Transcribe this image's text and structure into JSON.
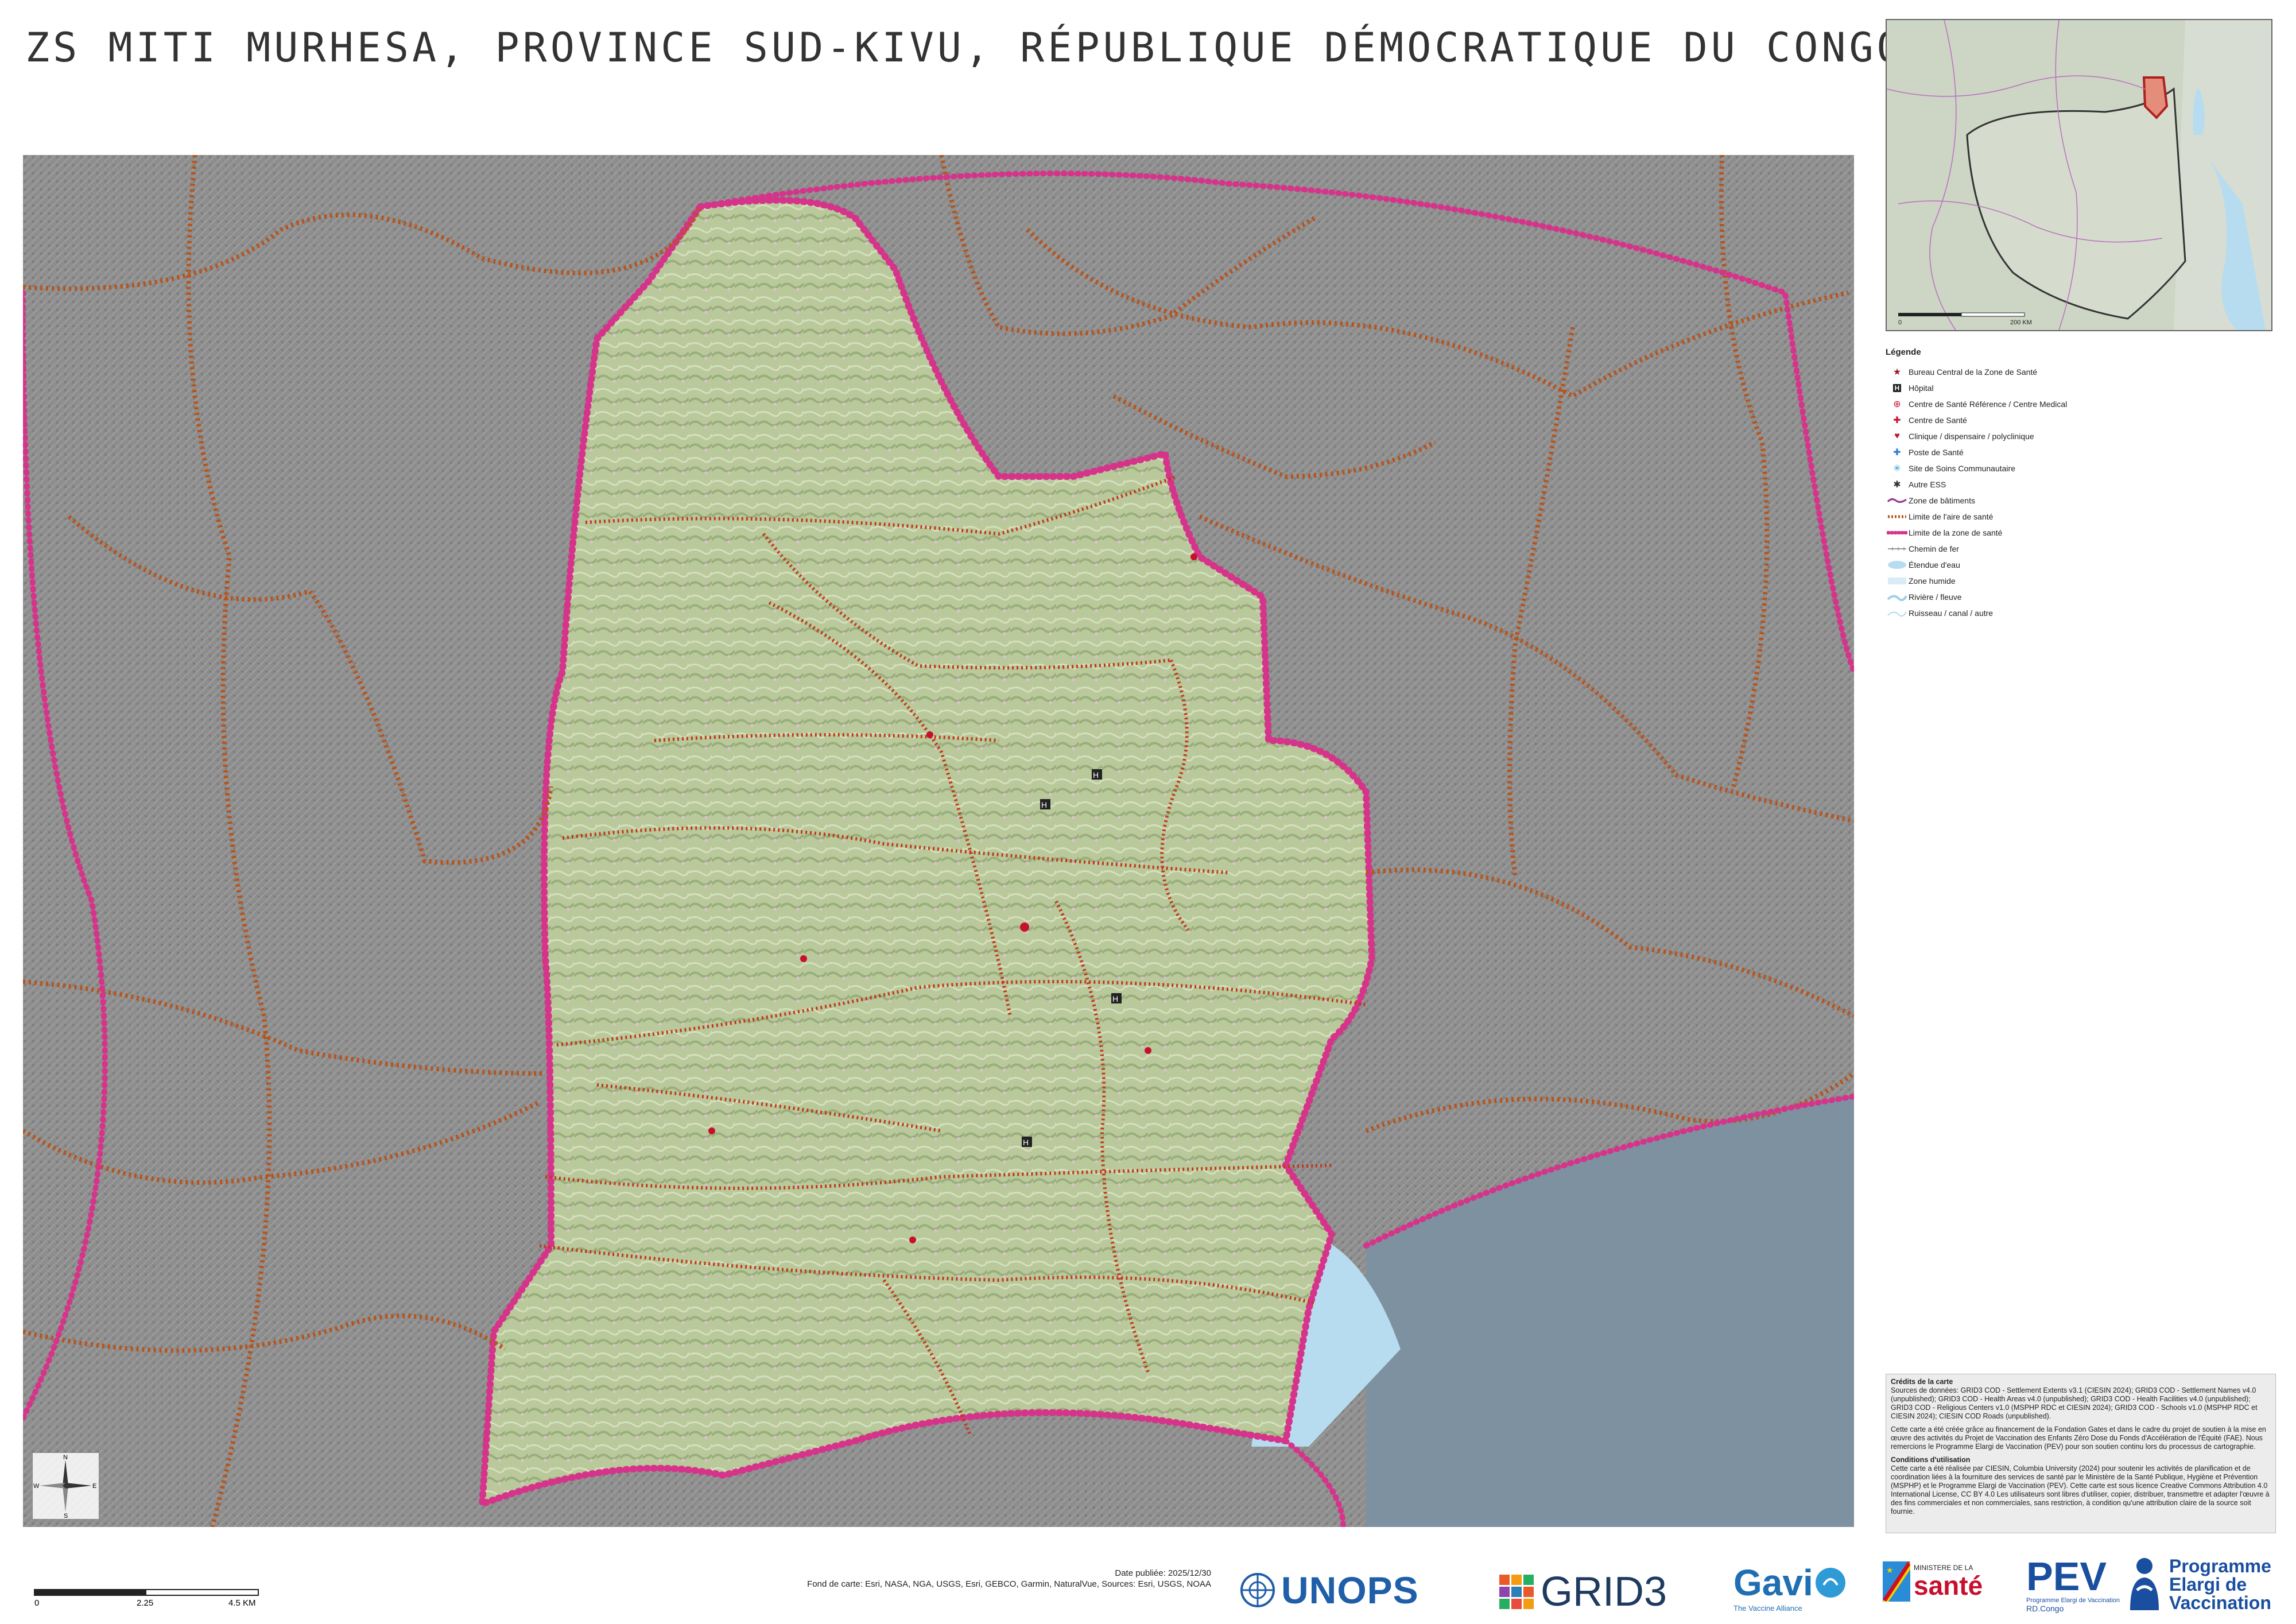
{
  "title": "ZS MITI MURHESA, PROVINCE SUD-KIVU, RÉPUBLIQUE DÉMOCRATIQUE DU CONGO",
  "colors": {
    "zone_boundary": "#d6338a",
    "area_boundary": "#b5541e",
    "outside_fill": "#8c8c8c",
    "inside_fill": "#b8c99a",
    "water": "#b7dcef",
    "lake_outside": "#7f93a3"
  },
  "inset": {
    "scale_start": "0",
    "scale_end": "200 KM"
  },
  "legend": {
    "title": "Légende",
    "items": [
      {
        "icon": "star-icon",
        "label": "Bureau Central de la Zone de Santé"
      },
      {
        "icon": "hospital-h-icon",
        "label": "Hôpital"
      },
      {
        "icon": "reference-health-center-icon",
        "label": "Centre de Santé Référence / Centre Medical"
      },
      {
        "icon": "health-center-icon",
        "label": "Centre de Santé"
      },
      {
        "icon": "clinic-icon",
        "label": "Clinique / dispensaire / polyclinique"
      },
      {
        "icon": "health-post-icon",
        "label": "Poste de Santé"
      },
      {
        "icon": "community-care-icon",
        "label": "Site de Soins Communautaire"
      },
      {
        "icon": "other-ess-icon",
        "label": "Autre ESS"
      },
      {
        "icon": "building-zone-icon",
        "label": "Zone de bâtiments"
      },
      {
        "icon": "health-area-line-icon",
        "label": "Limite de l'aire de santé"
      },
      {
        "icon": "health-zone-line-icon",
        "label": "Limite de la zone de santé"
      },
      {
        "icon": "railway-icon",
        "label": "Chemin de fer"
      },
      {
        "icon": "water-body-icon",
        "label": "Étendue d'eau"
      },
      {
        "icon": "wetland-icon",
        "label": "Zone humide"
      },
      {
        "icon": "river-icon",
        "label": "Rivière / fleuve"
      },
      {
        "icon": "stream-icon",
        "label": "Ruisseau / canal / autre"
      }
    ]
  },
  "credits": {
    "title": "Crédits de la carte",
    "sources": "Sources de données: GRID3 COD - Settlement Extents v3.1 (CIESIN 2024); GRID3 COD - Settlement Names v4.0 (unpublished); GRID3 COD - Health Areas v4.0 (unpublished); GRID3 COD - Health Facilities v4.0 (unpublished); GRID3 COD - Religious Centers v1.0 (MSPHP RDC et CIESIN 2024); GRID3 COD - Schools v1.0 (MSPHP RDC et CIESIN 2024); CIESIN COD Roads (unpublished).",
    "funding": "Cette carte a été créée grâce au financement de la Fondation Gates et dans le cadre du projet de soutien à la mise en œuvre des activités du Projet de Vaccination des Enfants Zéro Dose du Fonds d'Accélération de l'Équité (FAE). Nous remercions le Programme Elargi de Vaccination (PEV) pour son soutien continu lors du processus de cartographie.",
    "conditions_title": "Conditions d'utilisation",
    "conditions": "Cette carte a été réalisée par CIESIN, Columbia University (2024) pour soutenir les activités de planification et de coordination liées à la fourniture des services de santé par le Ministère de la Santé Publique, Hygiène et Prévention (MSPHP) et le Programme Elargi de Vaccination (PEV). Cette carte est sous licence Creative Commons Attribution 4.0 International License, CC BY 4.0 Les utilisateurs sont libres d'utiliser, copier, distribuer, transmettre et adapter l'œuvre à des fins commerciales et non commerciales, sans restriction, à condition qu'une attribution claire de la source soit fournie."
  },
  "compass": {
    "n": "N",
    "s": "S",
    "e": "E",
    "w": "W"
  },
  "scale": {
    "ticks": [
      "0",
      "2.25",
      "4.5 KM"
    ]
  },
  "publication": {
    "date": "Date publiée: 2025/12/30",
    "basemap": "Fond de carte: Esri, NASA, NGA, USGS, Esri, GEBCO, Garmin, NaturalVue, Sources: Esri, USGS, NOAA"
  },
  "logos": {
    "unops": "UNOPS",
    "grid3": "GRID3",
    "gavi": "Gavi",
    "gavi_tagline": "The Vaccine Alliance",
    "ministry_small": "MINISTERE DE LA",
    "ministry_big": "santé",
    "pev": "PEV",
    "pev_sub1": "Programme Elargi de Vaccination",
    "pev_sub2": "RD.Congo",
    "pev_full": "Programme\nElargi de\nVaccination"
  }
}
